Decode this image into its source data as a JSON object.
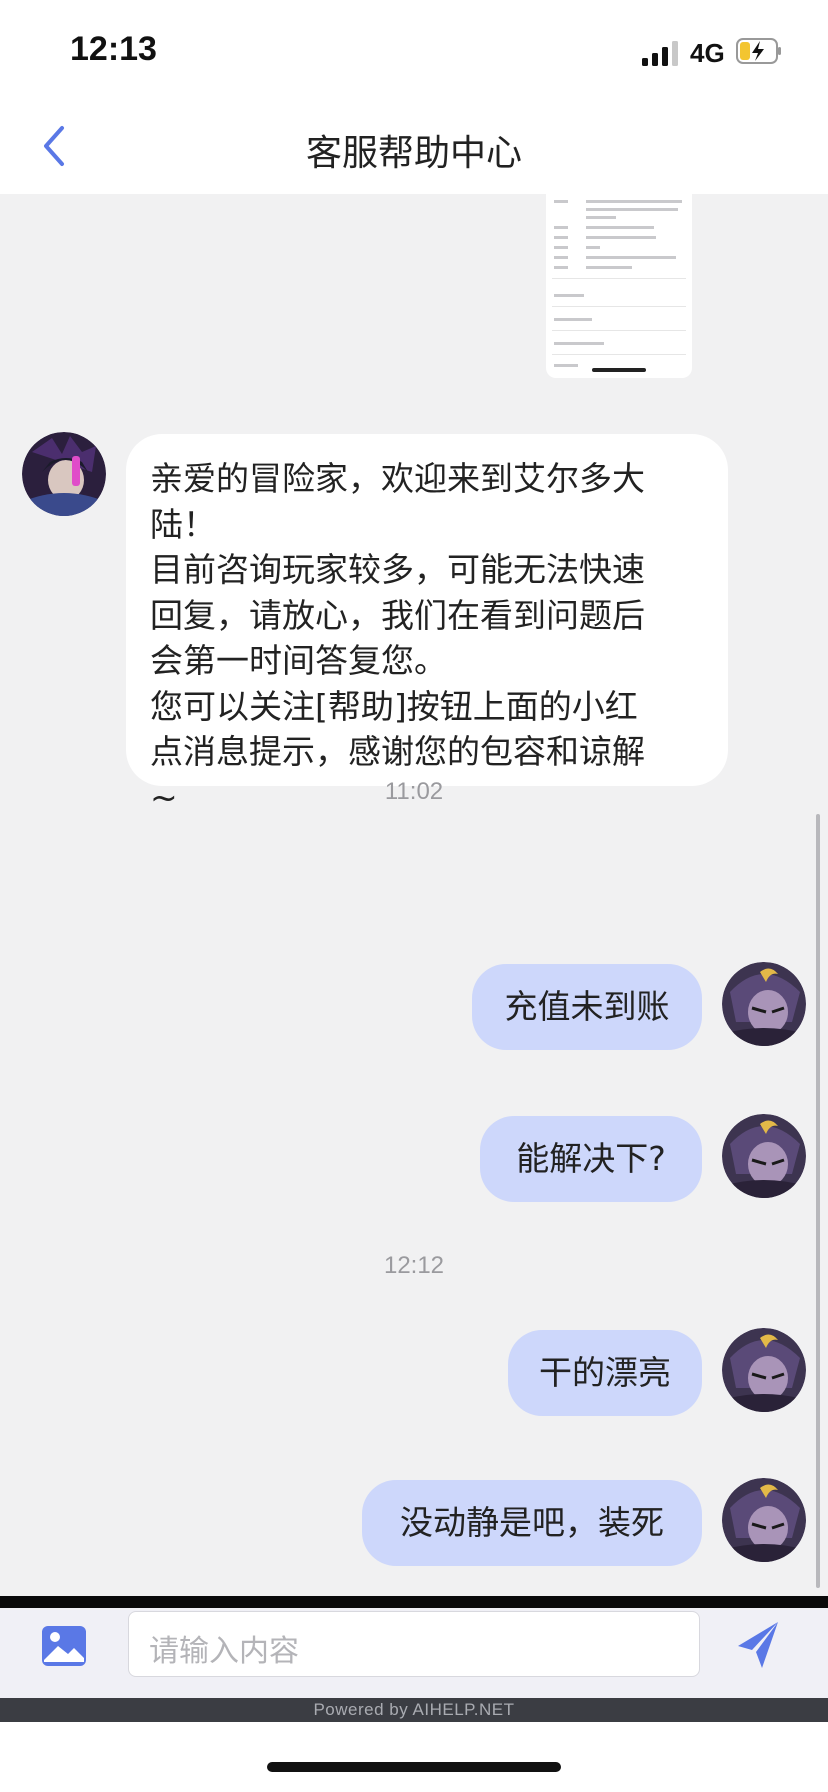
{
  "status_bar": {
    "time": "12:13",
    "network": "4G",
    "icons": [
      "signal-icon",
      "battery-charging-icon"
    ]
  },
  "header": {
    "title": "客服帮助中心",
    "back_icon": "chevron-left-icon"
  },
  "messages": [
    {
      "type": "image",
      "from": "user",
      "content": "screenshot-thumbnail"
    },
    {
      "type": "text",
      "from": "agent",
      "text": "亲爱的冒险家，欢迎来到艾尔多大\n陆！\n目前咨询玩家较多，可能无法快速\n回复，请放心，我们在看到问题后\n会第一时间答复您。\n您可以关注[帮助]按钮上面的小红\n点消息提示，感谢您的包容和谅解\n~"
    },
    {
      "type": "timestamp",
      "text": "11:02"
    },
    {
      "type": "text",
      "from": "user",
      "text": "充值未到账"
    },
    {
      "type": "text",
      "from": "user",
      "text": "能解决下?"
    },
    {
      "type": "timestamp",
      "text": "12:12"
    },
    {
      "type": "text",
      "from": "user",
      "text": "干的漂亮"
    },
    {
      "type": "text",
      "from": "user",
      "text": "没动静是吧，装死"
    }
  ],
  "input": {
    "placeholder": "请输入内容"
  },
  "footer": {
    "powered_by": "Powered by AIHELP.NET"
  },
  "colors": {
    "accent": "#5a78e6",
    "user_bubble": "#cdd7fb",
    "agent_bubble": "#ffffff",
    "background": "#f1f1f2"
  }
}
